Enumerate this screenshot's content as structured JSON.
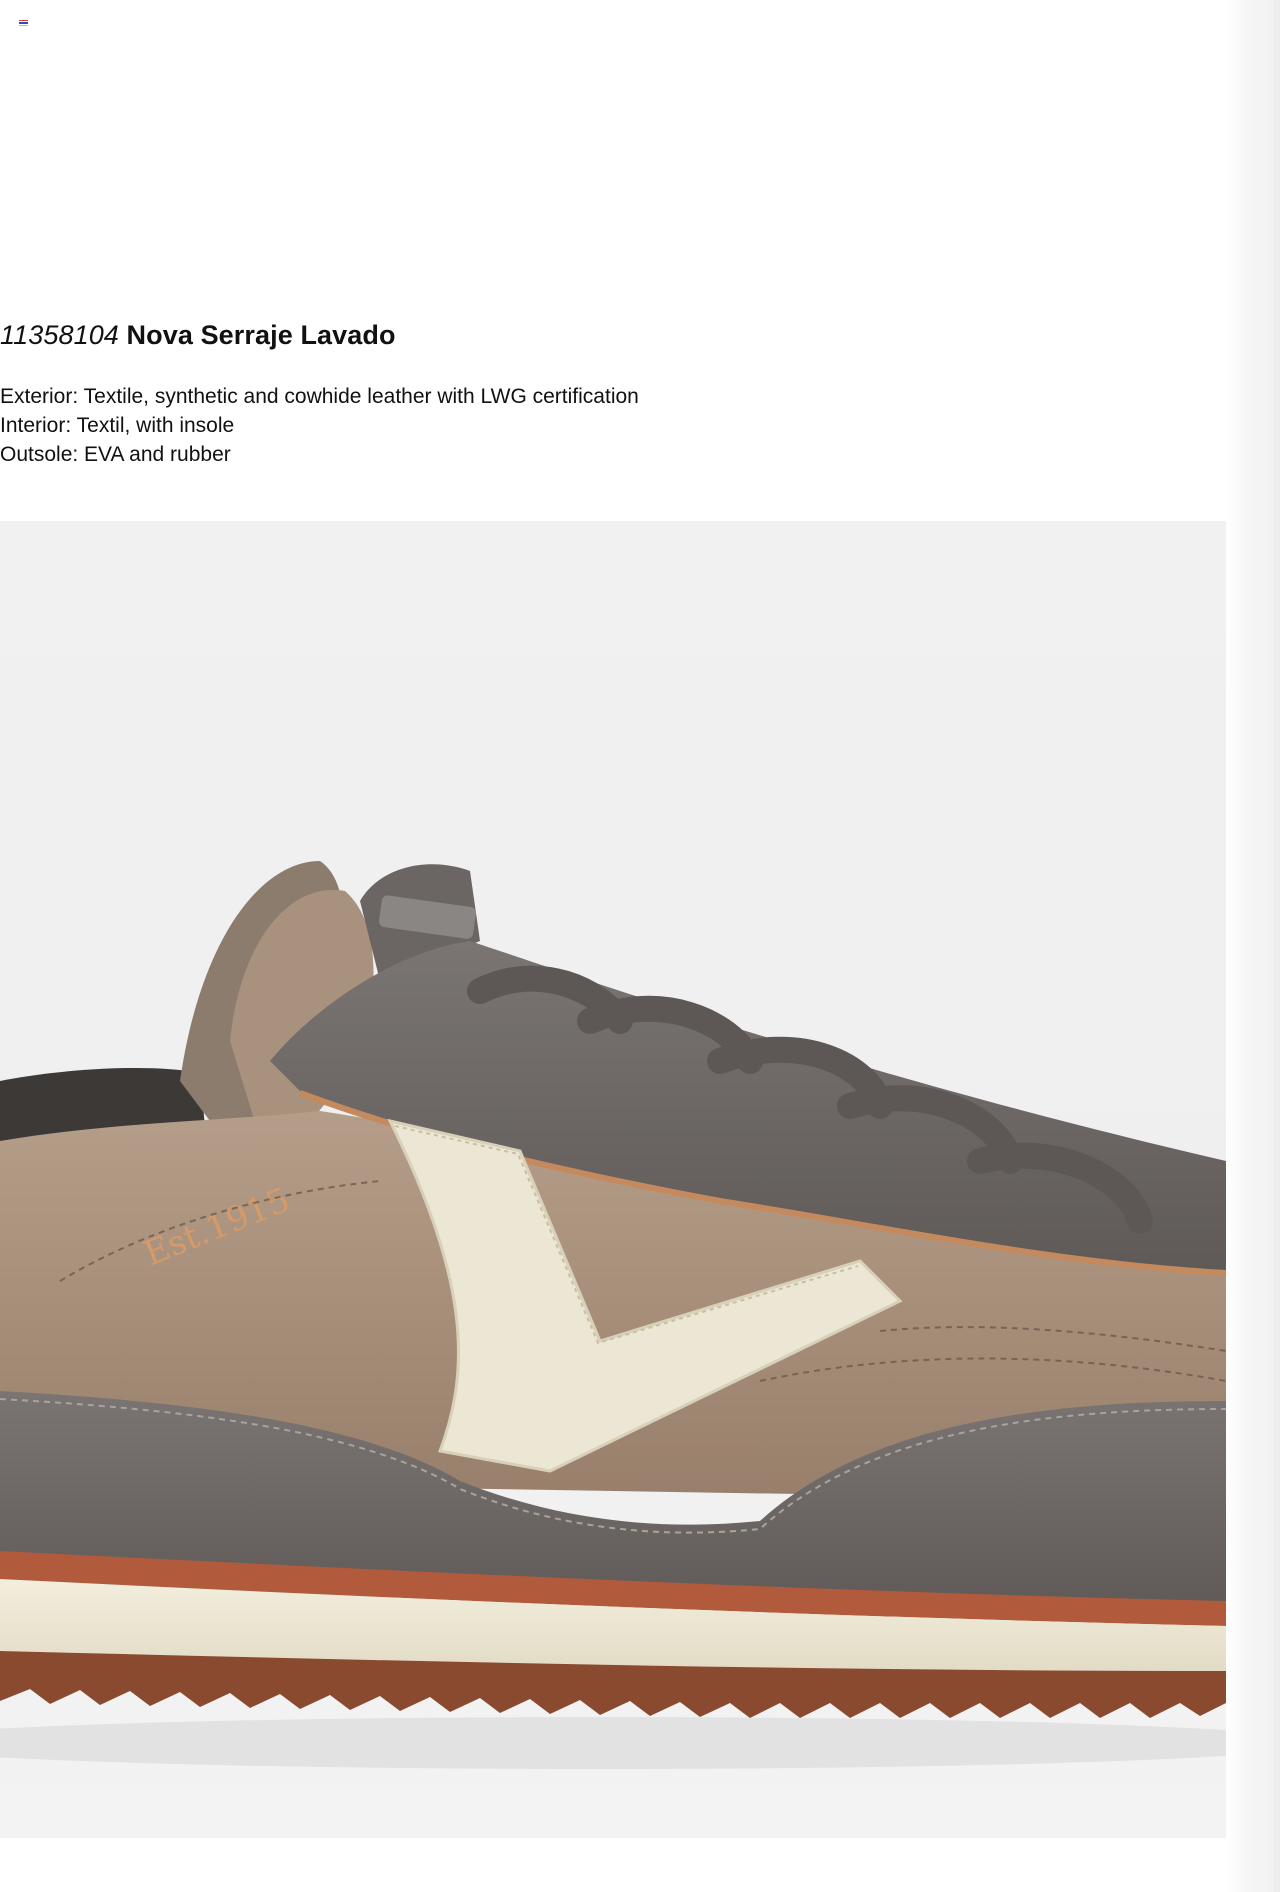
{
  "product": {
    "ref": "11358104",
    "name": "Nova Serraje Lavado",
    "specs": [
      "Exterior: Textile, synthetic and cowhide leather with LWG certification",
      "Interior: Textil, with insole",
      "Outsole: EVA and rubber"
    ]
  },
  "photo": {
    "logo_text": "Est.1915",
    "colors": {
      "nylon": "#a58d78",
      "suede": "#6f6a67",
      "cream": "#ece7d4",
      "sole_stripe": "#b25a3c",
      "background": "#efefef"
    }
  },
  "icons": {
    "language_flag": "flag-icon"
  }
}
